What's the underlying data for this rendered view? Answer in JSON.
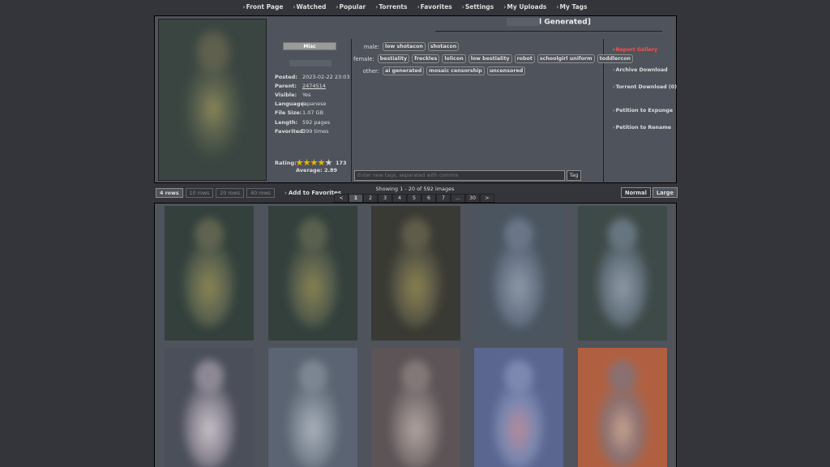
{
  "nav": [
    "Front Page",
    "Watched",
    "Popular",
    "Torrents",
    "Favorites",
    "Settings",
    "My Uploads",
    "My Tags"
  ],
  "gallery": {
    "title_visible": "l Generated]",
    "category": "Misc",
    "info": [
      {
        "key": "Posted:",
        "value": "2023-02-22 23:03",
        "link": false
      },
      {
        "key": "Parent:",
        "value": "2474514",
        "link": true
      },
      {
        "key": "Visible:",
        "value": "Yes",
        "link": false
      },
      {
        "key": "Language:",
        "value": "Japanese",
        "link": false
      },
      {
        "key": "File Size:",
        "value": "1.07 GB",
        "link": false
      },
      {
        "key": "Length:",
        "value": "592 pages",
        "link": false
      },
      {
        "key": "Favorited:",
        "value": "399 times",
        "link": false
      }
    ],
    "rating": {
      "label": "Rating:",
      "count": "173",
      "average": "Average: 2.89",
      "stars_filled": 4
    },
    "add_favorites": "Add to Favorites"
  },
  "tags": [
    {
      "ns": "male:",
      "tags": [
        "low shotacon",
        "shotacon"
      ]
    },
    {
      "ns": "female:",
      "tags": [
        "bestiality",
        "freckles",
        "lolicon",
        "low bestiality",
        "robot",
        "schoolgirl uniform",
        "toddlercon"
      ]
    },
    {
      "ns": "other:",
      "tags": [
        "ai generated",
        "mosaic censorship",
        "uncensored"
      ]
    }
  ],
  "tag_input": {
    "placeholder": "Enter new tags, separated with comma",
    "button": "Tag"
  },
  "actions": {
    "report": "Report Gallery",
    "archive": "Archive Download",
    "torrent": "Torrent Download (0)",
    "expunge": "Petition to Expunge",
    "rename": "Petition to Rename"
  },
  "rows_options": [
    "4 rows",
    "10 rows",
    "20 rows",
    "40 rows"
  ],
  "showing": "Showing 1 - 20 of 592 images",
  "pager": [
    "<",
    "1",
    "2",
    "3",
    "4",
    "5",
    "6",
    "7",
    "...",
    "30",
    ">"
  ],
  "size_options": [
    "Normal",
    "Large"
  ],
  "colors": {
    "accent_warn": "#ff4d4d",
    "star": "#e6b500"
  }
}
